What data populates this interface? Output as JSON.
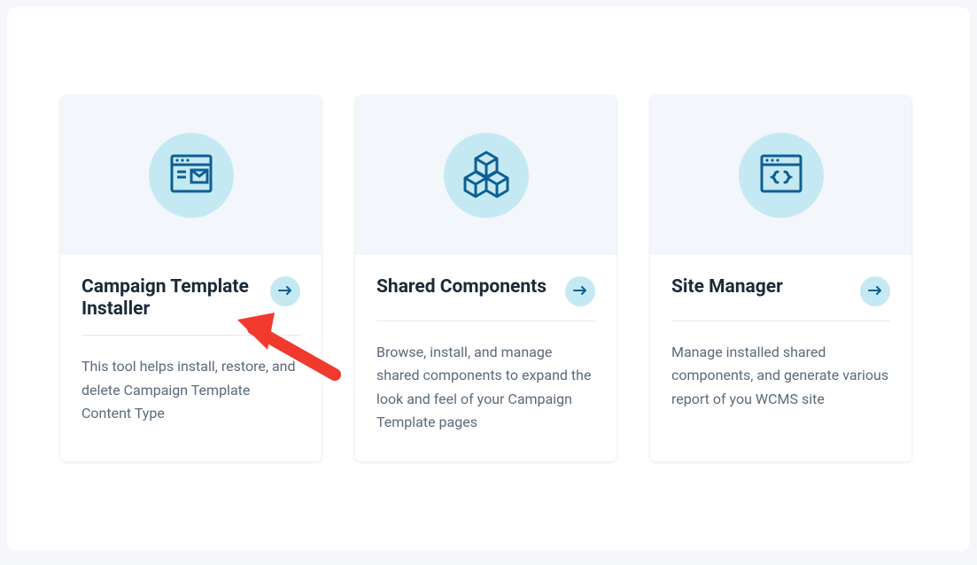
{
  "cards": [
    {
      "title": "Campaign Template Installer",
      "description": "This tool helps install, restore, and delete Campaign Template Content Type"
    },
    {
      "title": "Shared Components",
      "description": "Browse, install, and manage shared components to expand the look and feel of your Campaign Template pages"
    },
    {
      "title": "Site Manager",
      "description": "Manage installed shared components, and generate various report of you WCMS site"
    }
  ],
  "colors": {
    "iconStroke": "#0c5f94",
    "iconCircle": "#c5e9f3",
    "annotation": "#f03a2d"
  }
}
